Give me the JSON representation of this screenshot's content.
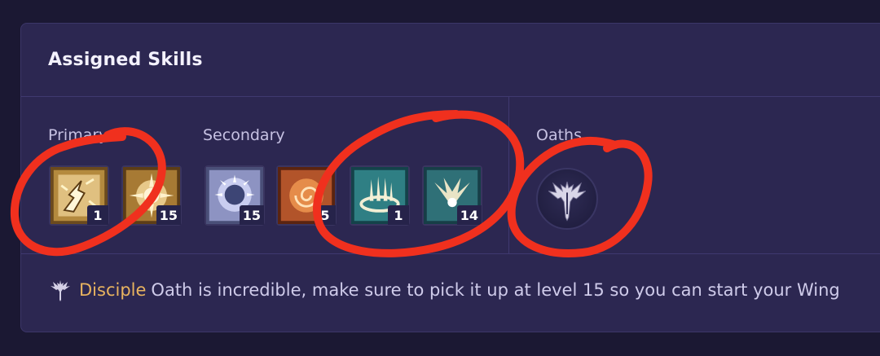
{
  "panel": {
    "title": "Assigned Skills",
    "groups": [
      {
        "label": "Primary"
      },
      {
        "label": "Secondary"
      },
      {
        "label": "Oaths"
      }
    ],
    "skills": [
      {
        "group": "Primary",
        "icon": "lightning-chain-icon",
        "rank": "1"
      },
      {
        "group": "Primary",
        "icon": "holy-burst-icon",
        "rank": "15"
      },
      {
        "group": "Secondary",
        "icon": "radiant-shield-icon",
        "rank": "15"
      },
      {
        "group": "Secondary",
        "icon": "spiral-flame-icon",
        "rank": "5"
      },
      {
        "group": "Secondary",
        "icon": "spear-circle-icon",
        "rank": "1"
      },
      {
        "group": "Secondary",
        "icon": "wing-burst-icon",
        "rank": "14"
      }
    ],
    "oath": {
      "icon": "winged-emblem-icon"
    }
  },
  "tip": {
    "highlight": "Disciple",
    "text": "Oath is incredible, make sure to pick it up at level 15 so you can start your Wing"
  },
  "colors": {
    "background": "#1b1833",
    "panel": "#2c2751",
    "highlight": "#e8b35f",
    "annotation": "#f0301e"
  }
}
